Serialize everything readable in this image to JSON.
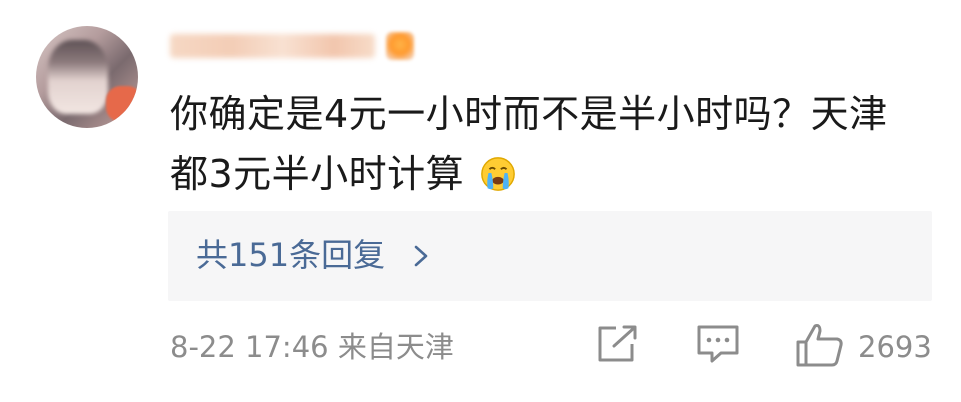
{
  "comment": {
    "text_line1": "你确定是4元一小时而不是半小时吗？天津",
    "text_line2": "都3元半小时计算",
    "emoji": "crying-face-icon"
  },
  "replies": {
    "label": "共151条回复"
  },
  "footer": {
    "meta": "8-22 17:46 来自天津",
    "like_count": "2693"
  },
  "colors": {
    "text": "#1a1a1a",
    "link": "#4a6a96",
    "muted": "#8c8c8c",
    "reply_box_bg": "#f6f6f7"
  }
}
